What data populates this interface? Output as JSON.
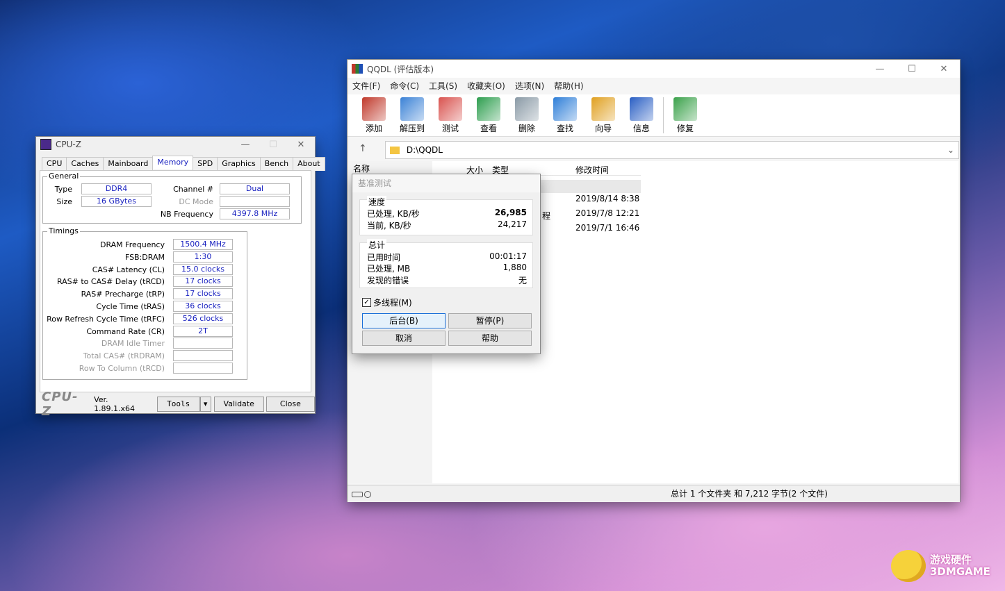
{
  "cpuz": {
    "title": "CPU-Z",
    "tabs": [
      "CPU",
      "Caches",
      "Mainboard",
      "Memory",
      "SPD",
      "Graphics",
      "Bench",
      "About"
    ],
    "general": {
      "label": "General",
      "type_label": "Type",
      "type": "DDR4",
      "size_label": "Size",
      "size": "16 GBytes",
      "channel_label": "Channel #",
      "channel": "Dual",
      "dcmode_label": "DC Mode",
      "dcmode": "",
      "nbfreq_label": "NB Frequency",
      "nbfreq": "4397.8 MHz"
    },
    "timings": {
      "label": "Timings",
      "rows": [
        {
          "label": "DRAM Frequency",
          "value": "1500.4 MHz",
          "dim": false
        },
        {
          "label": "FSB:DRAM",
          "value": "1:30",
          "dim": false
        },
        {
          "label": "CAS# Latency (CL)",
          "value": "15.0 clocks",
          "dim": false
        },
        {
          "label": "RAS# to CAS# Delay (tRCD)",
          "value": "17 clocks",
          "dim": false
        },
        {
          "label": "RAS# Precharge (tRP)",
          "value": "17 clocks",
          "dim": false
        },
        {
          "label": "Cycle Time (tRAS)",
          "value": "36 clocks",
          "dim": false
        },
        {
          "label": "Row Refresh Cycle Time (tRFC)",
          "value": "526 clocks",
          "dim": false
        },
        {
          "label": "Command Rate (CR)",
          "value": "2T",
          "dim": false
        },
        {
          "label": "DRAM Idle Timer",
          "value": "",
          "dim": true
        },
        {
          "label": "Total CAS# (tRDRAM)",
          "value": "",
          "dim": true
        },
        {
          "label": "Row To Column (tRCD)",
          "value": "",
          "dim": true
        }
      ]
    },
    "footer": {
      "logo": "CPU-Z",
      "version": "Ver. 1.89.1.x64",
      "tools": "Tools",
      "validate": "Validate",
      "close": "Close"
    }
  },
  "rar": {
    "title": "QQDL (评估版本)",
    "menu": [
      "文件(F)",
      "命令(C)",
      "工具(S)",
      "收藏夹(O)",
      "选项(N)",
      "帮助(H)"
    ],
    "tools": [
      {
        "label": "添加",
        "color": "#c0392b"
      },
      {
        "label": "解压到",
        "color": "#3b82d6"
      },
      {
        "label": "测试",
        "color": "#d9534f"
      },
      {
        "label": "查看",
        "color": "#2e9e4f"
      },
      {
        "label": "删除",
        "color": "#8a9aa6"
      },
      {
        "label": "查找",
        "color": "#2f7fd8"
      },
      {
        "label": "向导",
        "color": "#e0a020"
      },
      {
        "label": "信息",
        "color": "#2a5fc4"
      },
      {
        "label": "修复",
        "color": "#3aa14a"
      }
    ],
    "path": "D:\\QQDL",
    "columns": {
      "name": "名称",
      "size": "大小",
      "type": "类型",
      "modified": "修改时间"
    },
    "files": [
      {
        "type_partial": "",
        "modified": "2019/8/14 8:38"
      },
      {
        "type_partial": "程",
        "modified": "2019/7/8 12:21"
      },
      {
        "type_partial": "",
        "modified": "2019/7/1 16:46"
      }
    ],
    "status": "总计 1 个文件夹 和 7,212 字节(2 个文件)"
  },
  "bench": {
    "title": "基准测试",
    "speed": {
      "label": "速度",
      "processed_label": "已处理, KB/秒",
      "processed": "26,985",
      "current_label": "当前, KB/秒",
      "current": "24,217"
    },
    "total": {
      "label": "总计",
      "elapsed_label": "已用时间",
      "elapsed": "00:01:17",
      "processed_label": "已处理, MB",
      "processed": "1,880",
      "errors_label": "发现的错误",
      "errors": "无"
    },
    "multithread": "多线程(M)",
    "buttons": {
      "background": "后台(B)",
      "pause": "暂停(P)",
      "cancel": "取消",
      "help": "帮助"
    }
  },
  "watermark": "游戏硬件 3DMGAME"
}
